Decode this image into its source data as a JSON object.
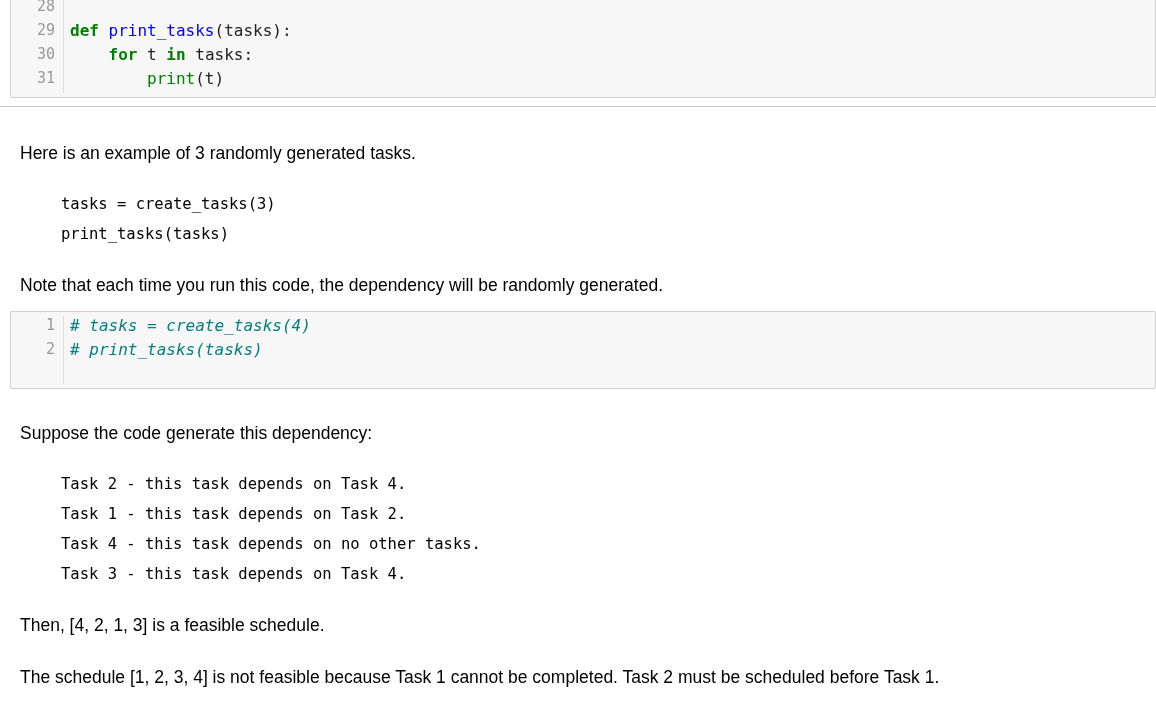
{
  "cells": [
    {
      "kind": "code",
      "lines": [
        {
          "number": "28"
        },
        {
          "number": "29",
          "tokens": [
            {
              "kind": "keyword",
              "text": "def "
            },
            {
              "kind": "function",
              "text": "print_tasks"
            },
            {
              "kind": "text",
              "text": "(tasks):"
            }
          ]
        },
        {
          "number": "30",
          "tokens": [
            {
              "kind": "keyword",
              "text": "    for"
            },
            {
              "kind": "text",
              "text": " t "
            },
            {
              "kind": "keyword",
              "text": "in"
            },
            {
              "kind": "text",
              "text": " tasks:"
            }
          ]
        },
        {
          "number": "31",
          "tokens": [
            {
              "kind": "builtin",
              "text": "        print"
            },
            {
              "kind": "text",
              "text": "(t)"
            }
          ]
        }
      ]
    },
    {
      "kind": "markdown",
      "blocks": [
        {
          "kind": "paragraph",
          "text": "Here is an example of 3 randomly generated tasks."
        },
        {
          "kind": "code",
          "lines": [
            "tasks = create_tasks(3)",
            "print_tasks(tasks)"
          ]
        },
        {
          "kind": "paragraph",
          "text": "Note that each time you run this code, the dependency will be randomly generated."
        }
      ]
    },
    {
      "kind": "code",
      "lines": [
        {
          "number": "1",
          "tokens": [
            {
              "kind": "comment",
              "text": "# tasks = create_tasks(4)"
            }
          ]
        },
        {
          "number": "2",
          "tokens": [
            {
              "kind": "comment",
              "text": "# print_tasks(tasks)"
            }
          ]
        }
      ]
    },
    {
      "kind": "markdown",
      "blocks": [
        {
          "kind": "paragraph",
          "text": "Suppose the code generate this dependency:"
        },
        {
          "kind": "code",
          "lines": [
            "Task 2 - this task depends on Task 4.",
            "Task 1 - this task depends on Task 2.",
            "Task 4 - this task depends on no other tasks.",
            "Task 3 - this task depends on Task 4."
          ]
        },
        {
          "kind": "paragraph",
          "text": "Then, [4, 2, 1, 3] is a feasible schedule."
        },
        {
          "kind": "paragraph",
          "text": "The schedule [1, 2, 3, 4] is not feasible because Task 1 cannot be completed. Task 2 must be scheduled before Task 1."
        }
      ]
    }
  ]
}
